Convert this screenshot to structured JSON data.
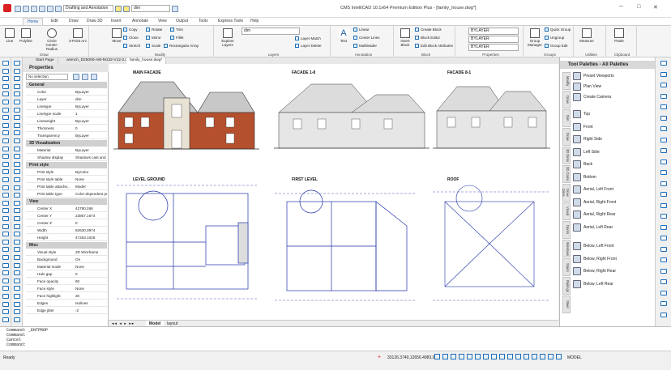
{
  "titlebar": {
    "workspace": "Drafting and Annotation",
    "layer_combo": "dim",
    "app_title": "CMS IntelliCAD 10.1x64 Premium Edition Plus - [family_house.dwg*]",
    "min": "─",
    "max": "□",
    "close": "✕"
  },
  "tabs": [
    "Home",
    "Edit",
    "Draw",
    "Draw 3D",
    "Insert",
    "Annotate",
    "View",
    "Output",
    "Tools",
    "Express Tools",
    "Help"
  ],
  "ribbon": {
    "draw": {
      "label": "Draw",
      "line": "Line",
      "polyline": "Polyline",
      "circle": "Circle",
      "circle_sub": "Center-Radius",
      "arc": "3-Point Arc"
    },
    "modify": {
      "label": "Modify",
      "move": "Move",
      "copy": "Copy",
      "rotate": "Rotate",
      "trim": "Trim",
      "clone": "Clone",
      "mirror": "Mirror",
      "fillet": "Fillet",
      "stretch": "Stretch",
      "scale": "Scale",
      "array": "Rectangular Array"
    },
    "layers": {
      "label": "Layers",
      "explore": "Explore Layers",
      "layer": "dim",
      "match": "Layer Match",
      "delete": "Layer Delete"
    },
    "annotation": {
      "label": "Annotation",
      "text": "Text",
      "linear": "Linear",
      "center_lines": "Center Lines",
      "multileader": "Multileader"
    },
    "block": {
      "label": "Block",
      "insert": "Insert Block",
      "create": "Create Block",
      "editor": "Block Editor",
      "attributes": "Edit Block Attributes"
    },
    "properties": {
      "label": "Properties",
      "color": "BYLAYER",
      "linetype": "BYLAYER",
      "lineweight": "BYLAYER"
    },
    "groups": {
      "label": "Groups",
      "manager": "Group Manager",
      "quick": "Quick Group",
      "ungroup": "Ungroup",
      "edit": "Group Edit"
    },
    "utilities": {
      "label": "Utilities",
      "measure": "Measure"
    },
    "clipboard": {
      "label": "Clipboard",
      "paste": "Paste"
    }
  },
  "doctabs": [
    "Start Page",
    "wsmch_D25000-AM-M132-V12-2.dwg*",
    "family_house.dwg*"
  ],
  "properties": {
    "title": "Properties",
    "selection": "No selection",
    "sections": [
      {
        "name": "General",
        "rows": [
          [
            "Color",
            "ByLayer"
          ],
          [
            "Layer",
            "dim"
          ],
          [
            "Linetype",
            "ByLayer"
          ],
          [
            "Linetype scale",
            "1"
          ],
          [
            "Lineweight",
            "ByLayer"
          ],
          [
            "Thickness",
            "0"
          ],
          [
            "Transparency",
            "ByLayer"
          ]
        ]
      },
      {
        "name": "3D Visualization",
        "rows": [
          [
            "Material",
            "ByLayer"
          ],
          [
            "Shadow display",
            "Shadows cast and"
          ]
        ]
      },
      {
        "name": "Print style",
        "rows": [
          [
            "Print style",
            "ByColor"
          ],
          [
            "Print style table",
            "None"
          ],
          [
            "Print table attache...",
            "Model"
          ],
          [
            "Print table type",
            "Color-dependent pr..."
          ]
        ]
      },
      {
        "name": "View",
        "rows": [
          [
            "Center X",
            "42780.266"
          ],
          [
            "Center Y",
            "23857.1674"
          ],
          [
            "Center Z",
            "0"
          ],
          [
            "Width",
            "82630.3974"
          ],
          [
            "Height",
            "47253.1026"
          ]
        ]
      },
      {
        "name": "Misc",
        "rows": [
          [
            "Visual style",
            "2D Wireframe"
          ],
          [
            "Background",
            "On"
          ],
          [
            "Material mode",
            "None"
          ],
          [
            "Halo gap",
            "0"
          ],
          [
            "Face opacity",
            "60"
          ],
          [
            "Face style",
            "None"
          ],
          [
            "Face highlight",
            "30"
          ],
          [
            "Edges",
            "Isolines"
          ],
          [
            "Edge jitter",
            "-2"
          ]
        ]
      }
    ]
  },
  "drawings": [
    "MAIN FACADE",
    "FACADE 1-8",
    "FACADE 8-1",
    "LEVEL GROUND",
    "FIRST LEVEL",
    "ROOF"
  ],
  "layout_tabs": [
    "Model",
    "layout"
  ],
  "palette": {
    "title": "Tool Palettes - All Palettes",
    "vtabs": [
      "Modify",
      "Draw",
      "Dim",
      "Draw",
      "3D Dims",
      "3D Cams",
      "Draw Dims",
      "Visual",
      "Doors",
      "Windows",
      "Stairs",
      "Railings",
      "Steel"
    ],
    "items": [
      "Preset Viewports",
      "Plan View",
      "Create Camera",
      "Top",
      "Front",
      "Right Side",
      "Left Side",
      "Back",
      "Bottom",
      "Aerial, Left Front",
      "Aerial, Right Front",
      "Aerial, Right Rear",
      "Aerial, Left Rear",
      "Below, Left Front",
      "Below, Right Front",
      "Below, Right Rear",
      "Below, Left Rear"
    ]
  },
  "command": {
    "lines": [
      "Command: _ENTPROP",
      "Command:",
      "Cancel",
      "Command:"
    ]
  },
  "status": {
    "ready": "Ready",
    "coords": "33126.3740,12656.4983,0",
    "model": "MODEL"
  },
  "colors": {
    "accent": "#1c5fa8",
    "drawing_blue": "#2233aa",
    "roof_red": "#b5502e"
  }
}
